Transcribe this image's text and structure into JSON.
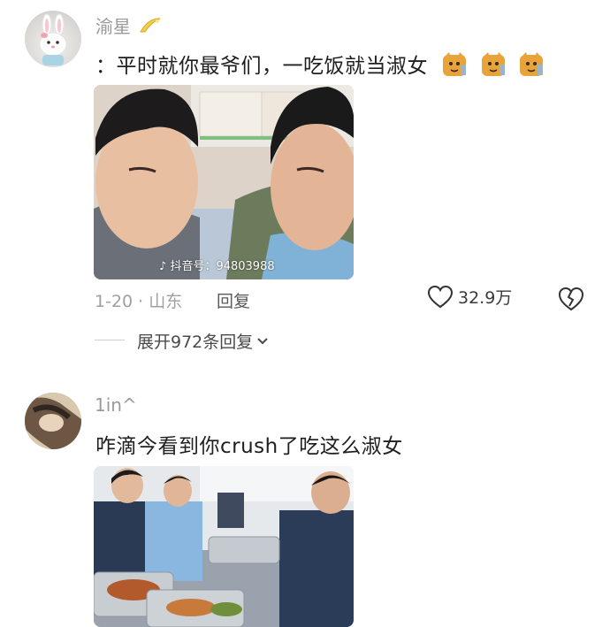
{
  "comments": [
    {
      "username": "渝星",
      "text": "：平时就你最爷们，一吃饭就当淑女",
      "photo_watermark": "抖音号：94803988",
      "date_location": "1-20 · 山东",
      "reply_label": "回复",
      "likes": "32.9万",
      "expand_replies": "展开972条回复"
    },
    {
      "username": "1in^",
      "text": "咋滴今看到你crush了吃这么淑女"
    }
  ],
  "colors": {
    "text": "#1f1f1f",
    "secondary": "#a0a0a0",
    "emoji": "#e8a33a"
  }
}
